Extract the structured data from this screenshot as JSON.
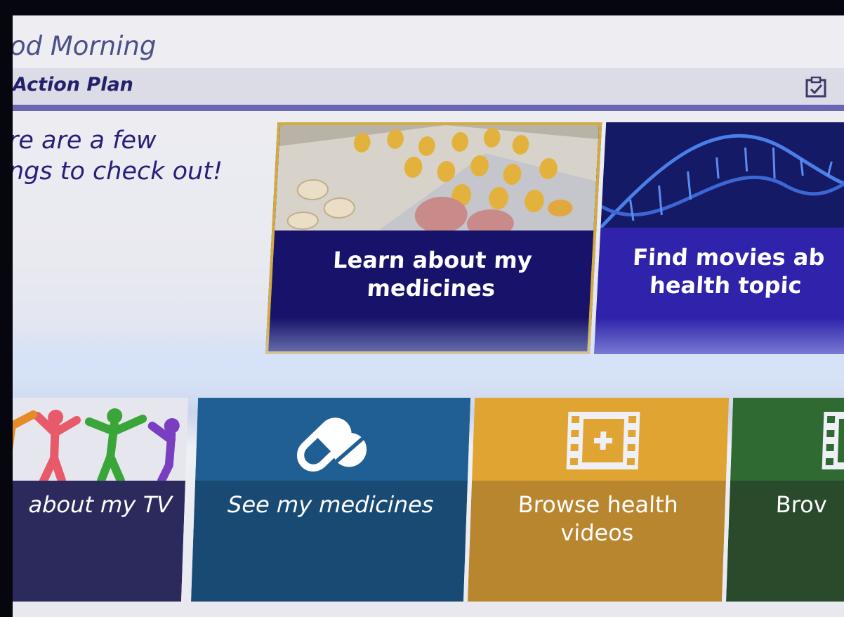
{
  "header": {
    "greeting": "od Morning",
    "action_plan_title": "Action Plan",
    "action_plan_icon": "clipboard-icon"
  },
  "intro": {
    "line1": "re are a few",
    "line2": "ngs to check out!"
  },
  "featured_cards": [
    {
      "line1": "Learn about my",
      "line2": "medicines",
      "image": "pills-photo",
      "selected": true
    },
    {
      "line1": "Find movies ab",
      "line2": "health topic",
      "image": "dna-helix-photo",
      "selected": false
    }
  ],
  "tiles": [
    {
      "label": "about my TV",
      "icon": "people-holding-hands-icon",
      "color": "#2c2a5c"
    },
    {
      "label": "See my medicines",
      "icon": "capsule-pill-icon",
      "color": "#1f5f94"
    },
    {
      "line1": "Browse health",
      "line2": "videos",
      "icon": "film-strip-plus-icon",
      "color": "#e0a432"
    },
    {
      "label": "Brov",
      "icon": "film-strip-icon",
      "color": "#2e6a32"
    }
  ],
  "colors": {
    "selection_border": "#d3ab44",
    "header_accent": "#6a66b4",
    "text_primary": "#26207a"
  }
}
